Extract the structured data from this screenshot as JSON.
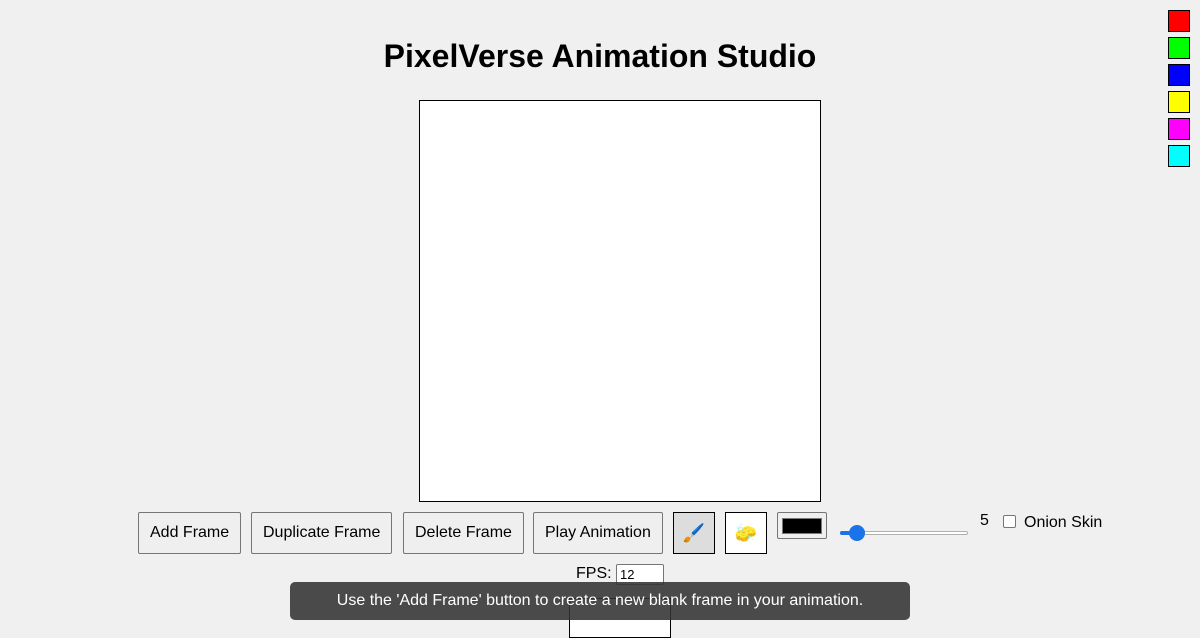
{
  "app": {
    "title": "PixelVerse Animation Studio"
  },
  "toolbar": {
    "add_frame": "Add Frame",
    "duplicate_frame": "Duplicate Frame",
    "delete_frame": "Delete Frame",
    "play_animation": "Play Animation",
    "brush_tool_glyph": "🖌️",
    "brush_tool_icon": "paintbrush-icon",
    "eraser_tool_glyph": "🧽",
    "eraser_tool_icon": "sponge-eraser-icon",
    "active_tool": "brush",
    "current_color": "#000000",
    "brush_size": "5",
    "brush_size_min": 1,
    "brush_size_max": 50,
    "onion_skin_label": "Onion Skin",
    "onion_skin_checked": false
  },
  "playback": {
    "fps_label": "FPS:",
    "fps_value": "12"
  },
  "tooltip": {
    "text": "Use the 'Add Frame' button to create a new blank frame in your animation."
  },
  "palette": {
    "colors": [
      "#ff0000",
      "#00ff00",
      "#0000ff",
      "#ffff00",
      "#ff00ff",
      "#00ffff"
    ]
  },
  "accent_color": "#1a73e8"
}
